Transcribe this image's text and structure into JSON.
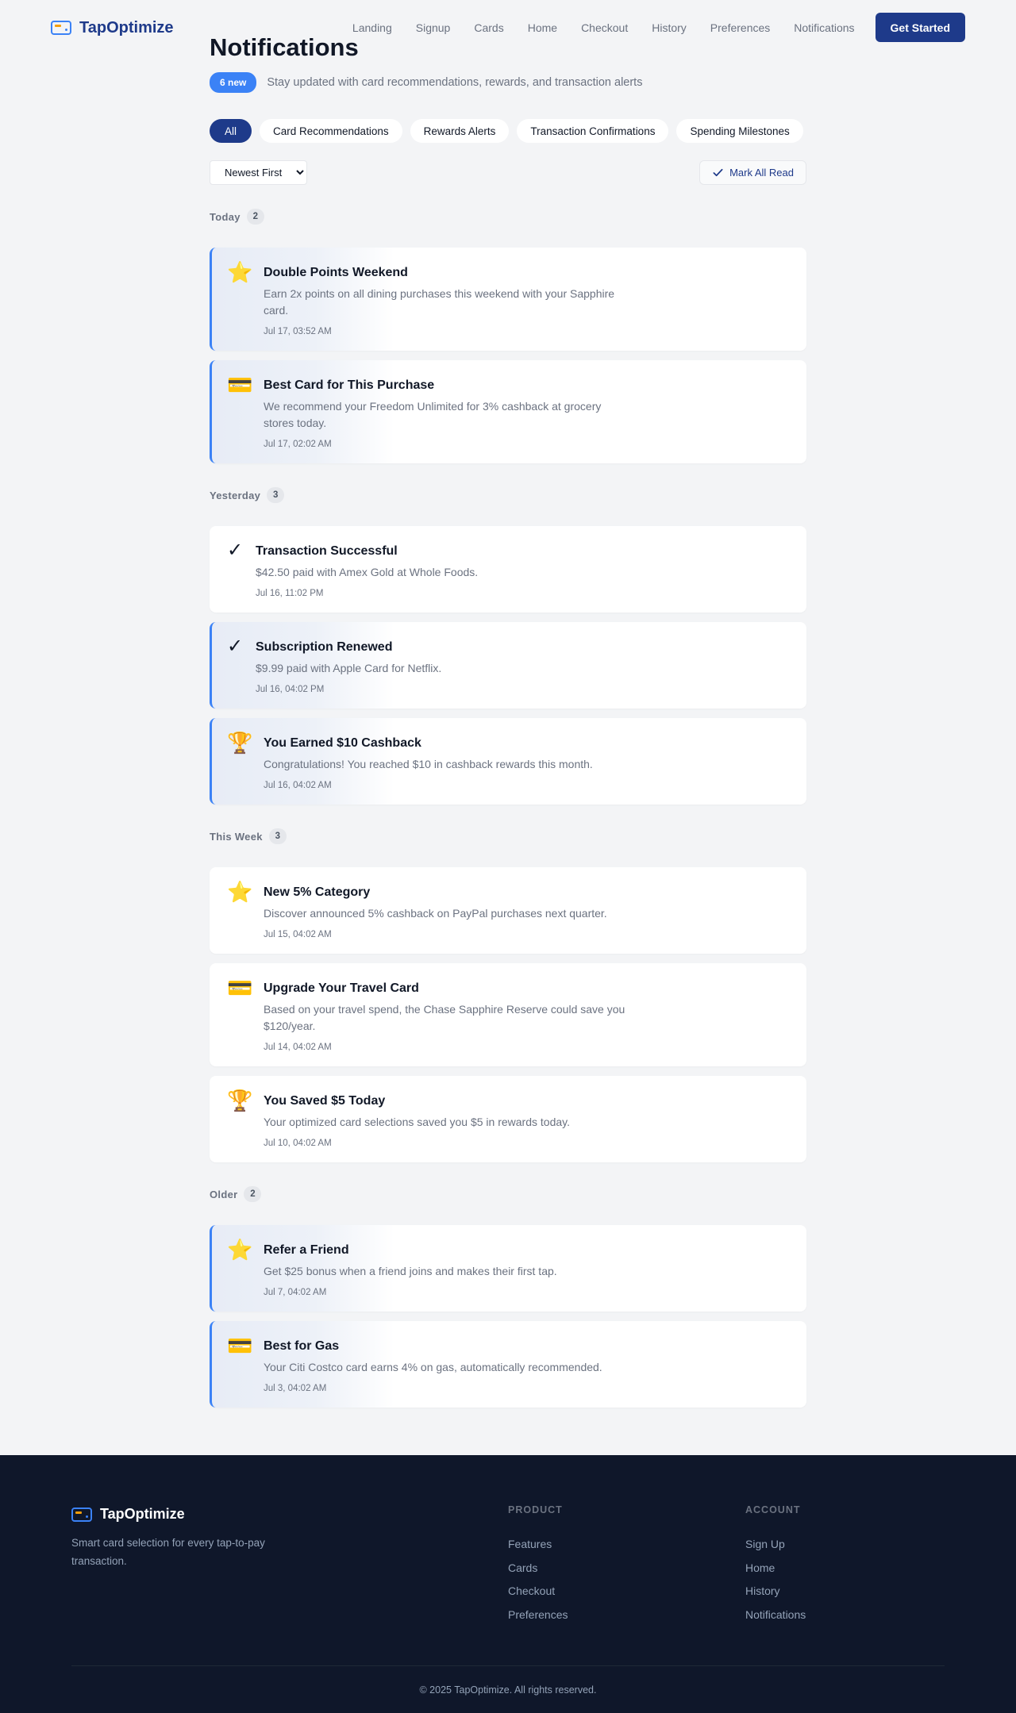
{
  "brand": {
    "name": "TapOptimize"
  },
  "nav": {
    "links": [
      "Landing",
      "Signup",
      "Cards",
      "Home",
      "Checkout",
      "History",
      "Preferences",
      "Notifications"
    ],
    "cta": "Get Started"
  },
  "page": {
    "title": "Notifications",
    "new_badge": "6 new",
    "subtitle": "Stay updated with card recommendations, rewards, and transaction alerts"
  },
  "filters": [
    "All",
    "Card Recommendations",
    "Rewards Alerts",
    "Transaction Confirmations",
    "Spending Milestones"
  ],
  "active_filter": "All",
  "sort": {
    "selected": "Newest First"
  },
  "mark_all_read": "Mark All Read",
  "groups": [
    {
      "title": "Today",
      "count": "2",
      "items": [
        {
          "icon": "star-icon",
          "glyph": "⭐",
          "unread": true,
          "title": "Double Points Weekend",
          "message": "Earn 2x points on all dining purchases this weekend with your Sapphire card.",
          "time": "Jul 17, 03:52 AM"
        },
        {
          "icon": "credit-card-icon",
          "glyph": "💳",
          "unread": true,
          "title": "Best Card for This Purchase",
          "message": "We recommend your Freedom Unlimited for 3% cashback at grocery stores today.",
          "time": "Jul 17, 02:02 AM"
        }
      ]
    },
    {
      "title": "Yesterday",
      "count": "3",
      "items": [
        {
          "icon": "checkmark-icon",
          "glyph": "✓",
          "unread": false,
          "title": "Transaction Successful",
          "message": "$42.50 paid with Amex Gold at Whole Foods.",
          "time": "Jul 16, 11:02 PM"
        },
        {
          "icon": "checkmark-icon",
          "glyph": "✓",
          "unread": true,
          "title": "Subscription Renewed",
          "message": "$9.99 paid with Apple Card for Netflix.",
          "time": "Jul 16, 04:02 PM"
        },
        {
          "icon": "trophy-icon",
          "glyph": "🏆",
          "unread": true,
          "title": "You Earned $10 Cashback",
          "message": "Congratulations! You reached $10 in cashback rewards this month.",
          "time": "Jul 16, 04:02 AM"
        }
      ]
    },
    {
      "title": "This Week",
      "count": "3",
      "items": [
        {
          "icon": "star-icon",
          "glyph": "⭐",
          "unread": false,
          "title": "New 5% Category",
          "message": "Discover announced 5% cashback on PayPal purchases next quarter.",
          "time": "Jul 15, 04:02 AM"
        },
        {
          "icon": "credit-card-icon",
          "glyph": "💳",
          "unread": false,
          "title": "Upgrade Your Travel Card",
          "message": "Based on your travel spend, the Chase Sapphire Reserve could save you $120/year.",
          "time": "Jul 14, 04:02 AM"
        },
        {
          "icon": "trophy-icon",
          "glyph": "🏆",
          "unread": false,
          "title": "You Saved $5 Today",
          "message": "Your optimized card selections saved you $5 in rewards today.",
          "time": "Jul 10, 04:02 AM"
        }
      ]
    },
    {
      "title": "Older",
      "count": "2",
      "items": [
        {
          "icon": "star-icon",
          "glyph": "⭐",
          "unread": true,
          "title": "Refer a Friend",
          "message": "Get $25 bonus when a friend joins and makes their first tap.",
          "time": "Jul 7, 04:02 AM"
        },
        {
          "icon": "credit-card-icon",
          "glyph": "💳",
          "unread": true,
          "title": "Best for Gas",
          "message": "Your Citi Costco card earns 4% on gas, automatically recommended.",
          "time": "Jul 3, 04:02 AM"
        }
      ]
    }
  ],
  "footer": {
    "brand": "TapOptimize",
    "tagline": "Smart card selection for every tap-to-pay transaction.",
    "product": {
      "heading": "PRODUCT",
      "links": [
        "Features",
        "Cards",
        "Checkout",
        "Preferences"
      ]
    },
    "account": {
      "heading": "ACCOUNT",
      "links": [
        "Sign Up",
        "Home",
        "History",
        "Notifications"
      ]
    },
    "copyright": "© 2025 TapOptimize. All rights reserved."
  },
  "colors": {
    "brand": "#1e3a8a",
    "accent": "#3b82f6",
    "footer_bg": "#0f172a",
    "page_bg": "#f3f4f6"
  }
}
